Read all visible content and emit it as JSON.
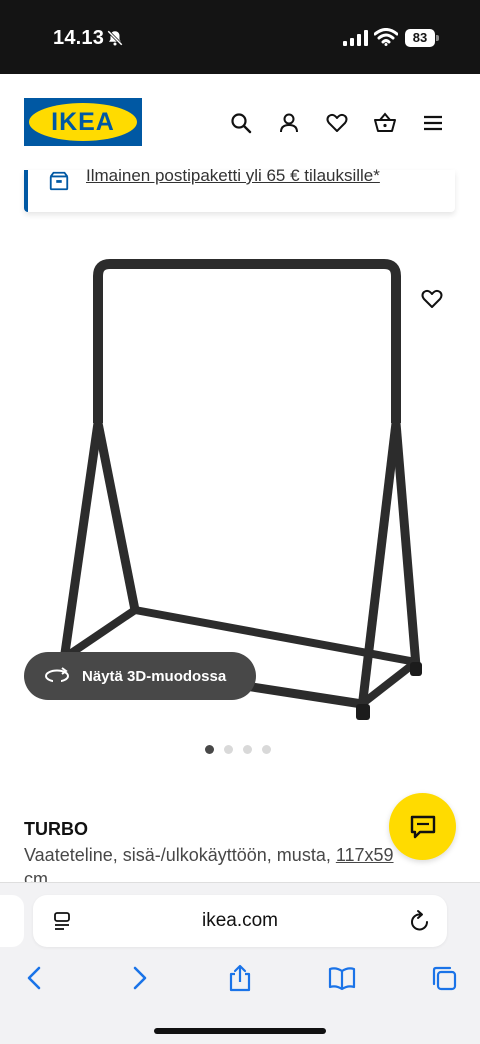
{
  "status_bar": {
    "time": "14.13",
    "battery": "83"
  },
  "header": {
    "logo_text": "IKEA"
  },
  "banner": {
    "text": "Ilmainen postipaketti yli 65 € tilauksille*"
  },
  "product": {
    "view_3d_label": "Näytä 3D-muodossa",
    "image_count": 4,
    "active_image": 1,
    "name": "TURBO",
    "description": "Vaateteline, sisä-/ulkokäyttöön, musta, ",
    "size_link": "117x59",
    "size_unit": "cm"
  },
  "browser": {
    "url": "ikea.com"
  },
  "colors": {
    "ikea_blue": "#0058a3",
    "ikea_yellow": "#ffdb00"
  }
}
